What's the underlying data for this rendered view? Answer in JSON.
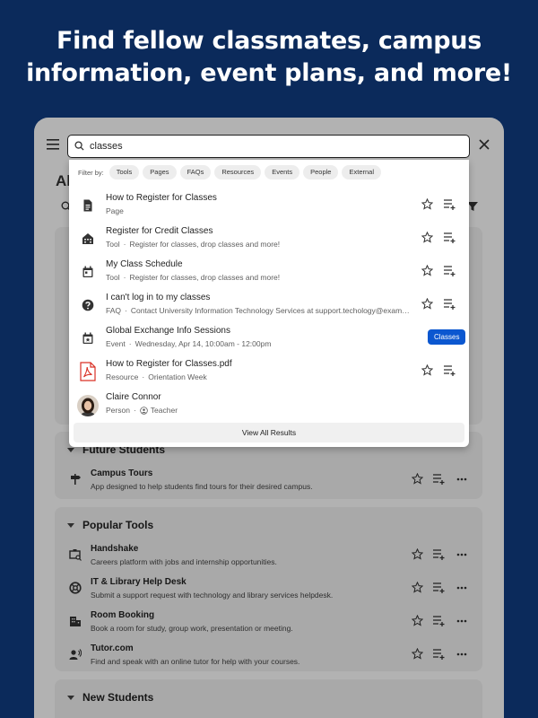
{
  "headline": {
    "line1": "Find fellow classmates, campus",
    "line2": "information, event plans, and more!"
  },
  "background": {
    "partial_title": "Al",
    "sections": [
      {
        "title": "Future Students",
        "items": [
          {
            "name": "Campus Tours",
            "desc": "App designed to help students find tours for their desired campus.",
            "icon": "signpost-icon"
          }
        ]
      },
      {
        "title": "Popular Tools",
        "items": [
          {
            "name": "Handshake",
            "desc": "Careers platform with jobs and internship opportunities.",
            "icon": "briefcase-search-icon"
          },
          {
            "name": "IT & Library Help Desk",
            "desc": "Submit a support request with technology and library services helpdesk.",
            "icon": "lifebuoy-icon"
          },
          {
            "name": "Room Booking",
            "desc": "Book a room for study, group work, presentation or meeting.",
            "icon": "building-icon"
          },
          {
            "name": "Tutor.com",
            "desc": "Find and speak with an online tutor for help with your courses.",
            "icon": "tutor-speak-icon"
          }
        ]
      },
      {
        "title": "New Students",
        "items": []
      }
    ]
  },
  "search": {
    "value": "classes",
    "filter_label": "Filter by:",
    "filters": [
      "Tools",
      "Pages",
      "FAQs",
      "Resources",
      "Events",
      "People",
      "External"
    ],
    "results": [
      {
        "title": "How to Register for Classes",
        "type": "Page",
        "detail": "",
        "icon": "document-icon"
      },
      {
        "title": "Register for Credit Classes",
        "type": "Tool",
        "detail": "Register for classes, drop classes and more!",
        "icon": "building-icon"
      },
      {
        "title": "My Class Schedule",
        "type": "Tool",
        "detail": "Register for classes, drop classes and more!",
        "icon": "calendar-icon"
      },
      {
        "title": "I can't log in to my classes",
        "type": "FAQ",
        "detail": "Contact University Information Technology Services at support.techology@exam…",
        "icon": "help-icon"
      },
      {
        "title": "Global Exchange Info Sessions",
        "type": "Event",
        "detail": "Wednesday, Apr 14, 10:00am - 12:00pm",
        "icon": "event-icon",
        "tag": "Classes"
      },
      {
        "title": "How to Register for Classes.pdf",
        "type": "Resource",
        "detail": "Orientation Week",
        "icon": "pdf-icon"
      },
      {
        "title": "Claire Connor",
        "type": "Person",
        "detail": "Teacher",
        "icon": "avatar"
      }
    ],
    "view_all_label": "View All Results"
  },
  "colors": {
    "brand_navy": "#0b2a5b",
    "tag_blue": "#0b57d0",
    "pdf_red": "#d93025"
  }
}
